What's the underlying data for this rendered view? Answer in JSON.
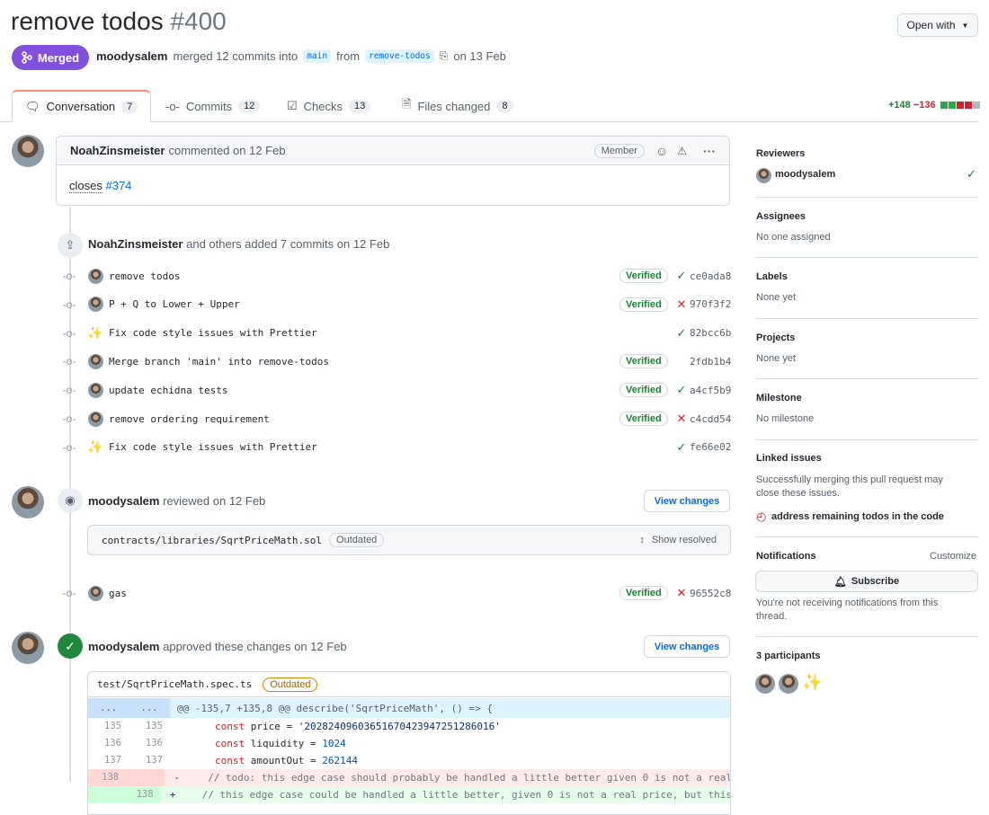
{
  "header": {
    "title": "remove todos",
    "number": "#400",
    "open_with": "Open with"
  },
  "status": {
    "merged_label": "Merged",
    "author": "moodysalem",
    "merged_text": "merged 12 commits into",
    "base_branch": "main",
    "from_text": "from",
    "head_branch": "remove-todos",
    "date_text": "on 13 Feb"
  },
  "tabs": [
    {
      "label": "Conversation",
      "count": "7"
    },
    {
      "label": "Commits",
      "count": "12"
    },
    {
      "label": "Checks",
      "count": "13"
    },
    {
      "label": "Files changed",
      "count": "8"
    }
  ],
  "diffstat": {
    "additions": "+148",
    "deletions": "−136"
  },
  "comment": {
    "author": "NoahZinsmeister",
    "meta": "commented on 12 Feb",
    "role": "Member",
    "body_text": "closes",
    "body_link": "#374"
  },
  "commits_event": {
    "author": "NoahZinsmeister",
    "text": "and others added 7 commits on 12 Feb"
  },
  "commits": [
    {
      "message": "remove todos",
      "verified": "Verified",
      "status": "success",
      "sha": "ce0ada8",
      "avatar": "user"
    },
    {
      "message": "P + Q to Lower + Upper",
      "verified": "Verified",
      "status": "failure",
      "sha": "970f3f2",
      "avatar": "user"
    },
    {
      "message": "Fix code style issues with Prettier",
      "verified": "",
      "status": "success",
      "sha": "82bcc6b",
      "avatar": "sparkle"
    },
    {
      "message": "Merge branch 'main' into remove-todos",
      "verified": "Verified",
      "status": "",
      "sha": "2fdb1b4",
      "avatar": "user"
    },
    {
      "message": "update echidna tests",
      "verified": "Verified",
      "status": "success",
      "sha": "a4cf5b9",
      "avatar": "user"
    },
    {
      "message": "remove ordering requirement",
      "verified": "Verified",
      "status": "failure",
      "sha": "c4cdd54",
      "avatar": "user"
    },
    {
      "message": "Fix code style issues with Prettier",
      "verified": "",
      "status": "success",
      "sha": "fe66e02",
      "avatar": "sparkle"
    }
  ],
  "review1": {
    "author": "moodysalem",
    "text": "reviewed on 12 Feb",
    "button": "View changes",
    "file": "contracts/libraries/SqrtPriceMath.sol",
    "outdated": "Outdated",
    "show_resolved": "Show resolved"
  },
  "gas_commit": {
    "message": "gas",
    "verified": "Verified",
    "sha": "96552c8"
  },
  "review2": {
    "author": "moodysalem",
    "text": "approved these changes on 12 Feb",
    "button": "View changes",
    "file": "test/SqrtPriceMath.spec.ts",
    "outdated": "Outdated"
  },
  "diff": {
    "hunk": "@@ -135,7 +135,8 @@ describe('SqrtPriceMath', () => {",
    "ellipsis": "...",
    "lines": [
      {
        "old": "135",
        "new": "135",
        "sign": "",
        "kw": "const",
        "name": " price = ",
        "val": "'20282409603651670423947251286016'",
        "type": "ctx",
        "valclass": "str"
      },
      {
        "old": "136",
        "new": "136",
        "sign": "",
        "kw": "const",
        "name": " liquidity = ",
        "val": "1024",
        "type": "ctx",
        "valclass": "num"
      },
      {
        "old": "137",
        "new": "137",
        "sign": "",
        "kw": "const",
        "name": " amountOut = ",
        "val": "262144",
        "type": "ctx",
        "valclass": "num"
      },
      {
        "old": "138",
        "new": "",
        "sign": "-",
        "kw": "",
        "name": "// todo: this edge case should probably be handled a little better given 0 is not a real",
        "val": "",
        "type": "del",
        "valclass": ""
      },
      {
        "old": "",
        "new": "138",
        "sign": "+",
        "kw": "",
        "name": "// this edge case could be handled a little better, given 0 is not a real price, but this",
        "val": "",
        "type": "add",
        "valclass": ""
      }
    ]
  },
  "sidebar": {
    "reviewers_h": "Reviewers",
    "reviewer": "moodysalem",
    "assignees_h": "Assignees",
    "assignees_t": "No one assigned",
    "labels_h": "Labels",
    "labels_t": "None yet",
    "projects_h": "Projects",
    "projects_t": "None yet",
    "milestone_h": "Milestone",
    "milestone_t": "No milestone",
    "linked_h": "Linked issues",
    "linked_t1": "Successfully merging this pull request may",
    "linked_t2": "close these issues.",
    "linked_issue": "address remaining todos in the code",
    "notif_h": "Notifications",
    "notif_customize": "Customize",
    "subscribe": "Subscribe",
    "notif_t1": "You're not receiving notifications from this",
    "notif_t2": "thread.",
    "participants_h": "3 participants"
  },
  "colors": {
    "merged": "#8250df",
    "success": "#1a7f37",
    "failure": "#cf222e",
    "link": "#0969da"
  }
}
